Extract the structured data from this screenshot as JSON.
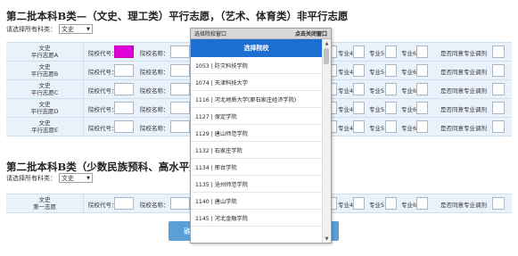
{
  "section1": {
    "title": "第二批本科B类—（文史、理工类）平行志愿，（艺术、体育类）非平行志愿",
    "subject_label": "请选择所有科类：",
    "subject_value": "文史"
  },
  "section2": {
    "title": "第二批本科B类（少数民族预科、高水平运动队）",
    "subject_label": "请选择所有科类：",
    "subject_value": "文史"
  },
  "field_labels": {
    "code": "院校代号：",
    "name": "院校名称：",
    "major4": "专业4",
    "major5": "专业5",
    "major6": "专业6",
    "adjust": "是否同意专业调剂"
  },
  "rows1": [
    {
      "line1": "文史",
      "line2": "平行志愿A"
    },
    {
      "line1": "文史",
      "line2": "平行志愿B"
    },
    {
      "line1": "文史",
      "line2": "平行志愿C"
    },
    {
      "line1": "文史",
      "line2": "平行志愿D"
    },
    {
      "line1": "文史",
      "line2": "平行志愿E"
    }
  ],
  "rows2": [
    {
      "line1": "文史",
      "line2": "第一志愿"
    }
  ],
  "popup": {
    "header_title": "选择院校窗口",
    "close_label": "点击关闭窗口",
    "list_title": "选择院校",
    "options": [
      "1053 | 防灾科技学院",
      "1074 | 天津科技大学",
      "1116 | 河北地质大学(原石家庄经济学院)",
      "1127 | 保定学院",
      "1129 | 唐山师范学院",
      "1132 | 石家庄学院",
      "1134 | 邢台学院",
      "1135 | 沧州师范学院",
      "1140 | 唐山学院",
      "1145 | 河北金融学院"
    ]
  },
  "buttons": {
    "submit_partial": "确认"
  },
  "colors": {
    "row_bg": "#e9f2fa",
    "popup_title_bg": "#1c6fd0",
    "highlight_input": "#e000d8",
    "button_bg": "#5a9fd8"
  }
}
